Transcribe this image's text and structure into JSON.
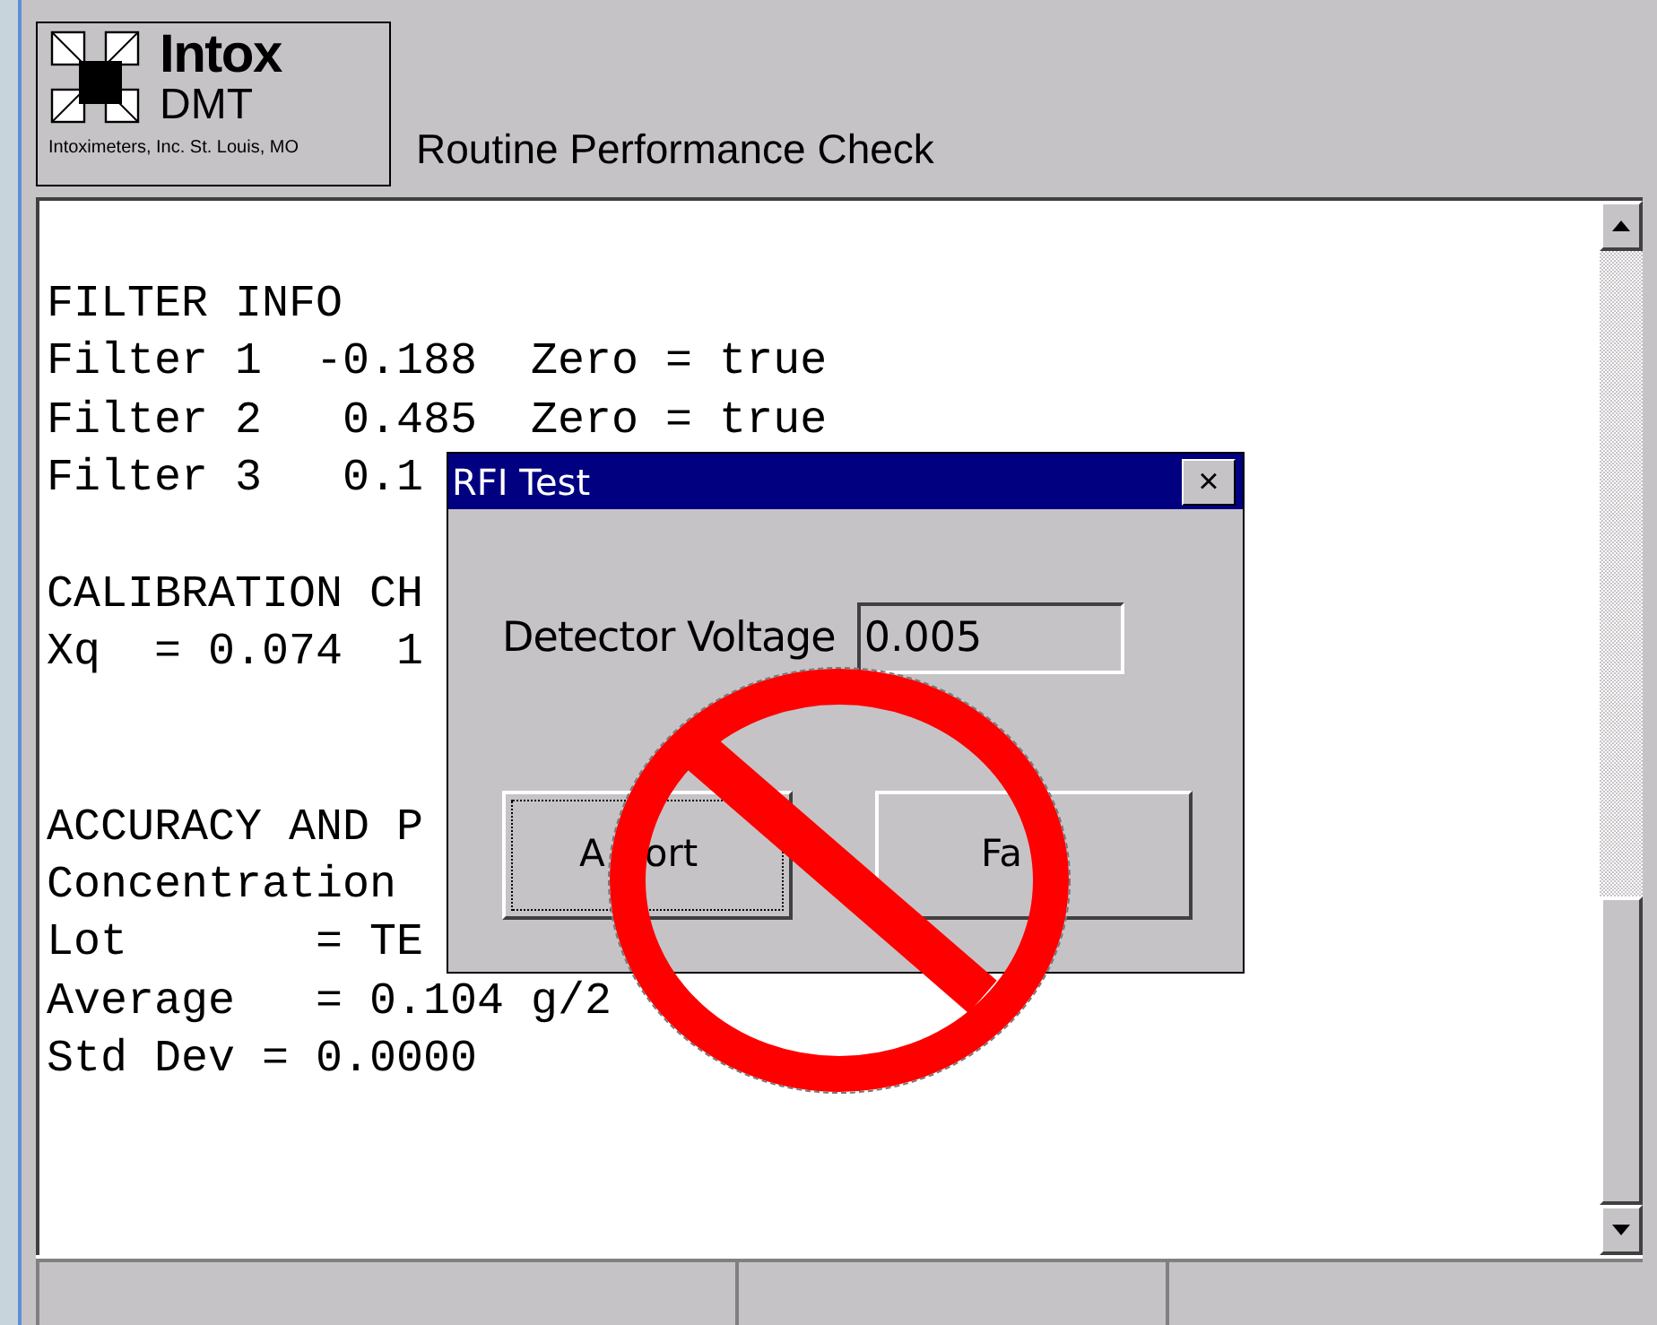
{
  "header": {
    "logo_name": "Intox",
    "logo_model": "DMT",
    "logo_caption": "Intoximeters, Inc. St. Louis, MO",
    "title": "Routine Performance Check"
  },
  "report_blocks": [
    {
      "lines": [
        "FILTER INFO",
        "Filter 1  -0.188  Zero = true",
        "Filter 2   0.485  Zero = true",
        "Filter 3   0.1"
      ]
    },
    {
      "lines": [
        "CALIBRATION CH",
        "Xq  = 0.074  1"
      ]
    },
    {
      "lines": [
        "ACCURACY AND P",
        "Concentration",
        "Lot       = TE",
        "Average   = 0.104 g/2",
        "Std Dev = 0.0000"
      ]
    }
  ],
  "dialog": {
    "title": "RFI Test",
    "close": "×",
    "field_label": "Detector Voltage",
    "field_value": "0.005",
    "buttons": [
      {
        "label_parts": [
          "A",
          "ort"
        ],
        "focused": true
      },
      {
        "label_parts": [
          "Fa"
        ],
        "focused": false
      }
    ]
  }
}
